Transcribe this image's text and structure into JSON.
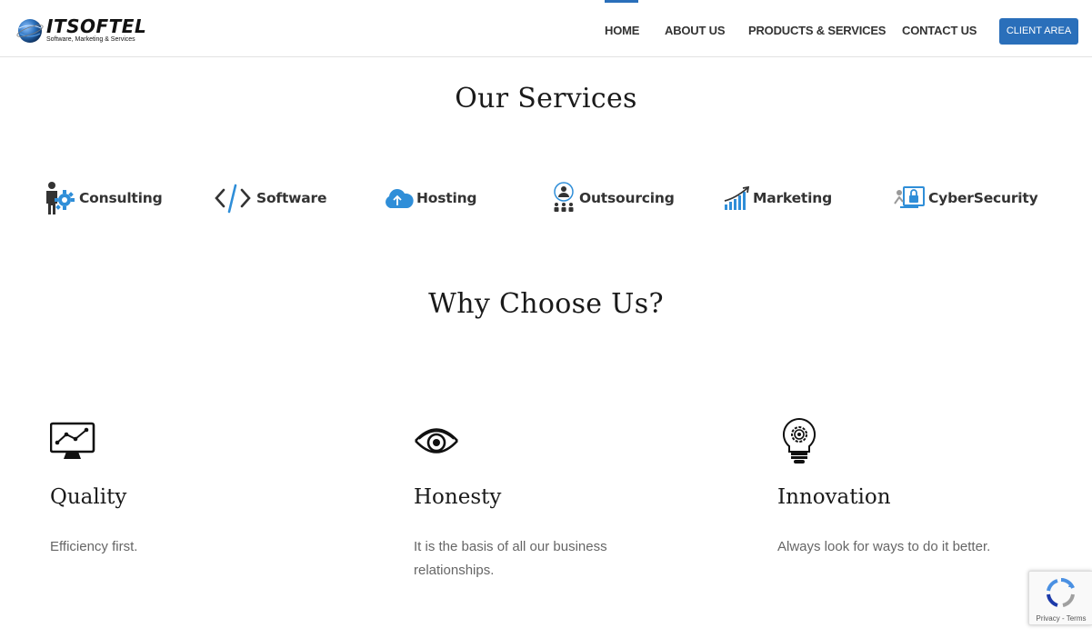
{
  "brand": {
    "name": "ITSOFTEL",
    "tagline": "Software, Marketing & Services"
  },
  "nav": {
    "items": [
      {
        "label": "HOME",
        "active": true
      },
      {
        "label": "ABOUT US",
        "active": false
      },
      {
        "label": "PRODUCTS & SERVICES",
        "active": false
      },
      {
        "label": "CONTACT US",
        "active": false
      }
    ],
    "cta_label": "CLIENT AREA"
  },
  "services": {
    "title": "Our Services",
    "items": [
      {
        "label": "Consulting",
        "icon": "consulting-icon"
      },
      {
        "label": "Software",
        "icon": "code-icon"
      },
      {
        "label": "Hosting",
        "icon": "cloud-upload-icon"
      },
      {
        "label": "Outsourcing",
        "icon": "team-icon"
      },
      {
        "label": "Marketing",
        "icon": "growth-chart-icon"
      },
      {
        "label": "CyberSecurity",
        "icon": "lock-screen-icon"
      }
    ]
  },
  "why": {
    "title": "Why Choose Us?",
    "features": [
      {
        "title": "Quality",
        "description": "Efficiency first.",
        "icon": "monitor-chart-icon"
      },
      {
        "title": "Honesty",
        "description": "It is the basis of all our business relationships.",
        "icon": "eye-icon"
      },
      {
        "title": "Innovation",
        "description": "Always look for ways to do it better.",
        "icon": "lightbulb-gear-icon"
      }
    ]
  },
  "recaptcha": {
    "links": "Privacy - Terms"
  },
  "colors": {
    "accent": "#2a6fba",
    "icon_blue": "#2f8ed8",
    "text_dark": "#1a1a1a",
    "text_muted": "#666666"
  }
}
